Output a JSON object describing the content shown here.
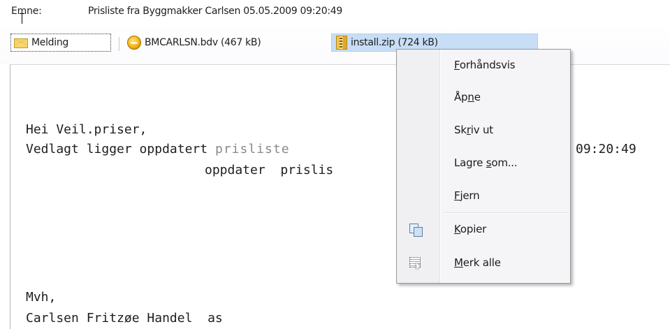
{
  "subject": {
    "label": "Emne:",
    "value": "Prisliste fra Byggmakker Carlsen  05.05.2009 09:20:49"
  },
  "attachments": [
    {
      "label": "Melding",
      "icon": "envelope-icon"
    },
    {
      "label": "BMCARLSN.bdv (467 kB)",
      "icon": "coin-icon"
    },
    {
      "label": "install.zip (724 kB)",
      "icon": "zip-icon"
    }
  ],
  "message": {
    "greeting": "Hei Veil.priser,",
    "line1_start": "Vedlagt ligger oppdatert ",
    "line1_hidden": "prisliste",
    "line1_end": "09:20:49",
    "line2": "oppdater  prislis",
    "closing": "Mvh,",
    "signature": "Carlsen Fritzøe Handel  as"
  },
  "context_menu": {
    "items": [
      {
        "pre": "",
        "key": "F",
        "post": "orhåndsvis"
      },
      {
        "pre": "Åp",
        "key": "n",
        "post": "e"
      },
      {
        "pre": "Sk",
        "key": "r",
        "post": "iv ut"
      },
      {
        "pre": "Lagre ",
        "key": "s",
        "post": "om..."
      },
      {
        "pre": "",
        "key": "F",
        "post": "jern"
      },
      {
        "pre": "",
        "key": "K",
        "post": "opier",
        "icon": "copy-icon"
      },
      {
        "pre": "",
        "key": "M",
        "post": "erk alle",
        "icon": "select-all-icon"
      }
    ]
  },
  "colors": {
    "selected_tab": "#c8def7",
    "menu_bg": "#f5f5f7",
    "menu_border": "#979797"
  }
}
